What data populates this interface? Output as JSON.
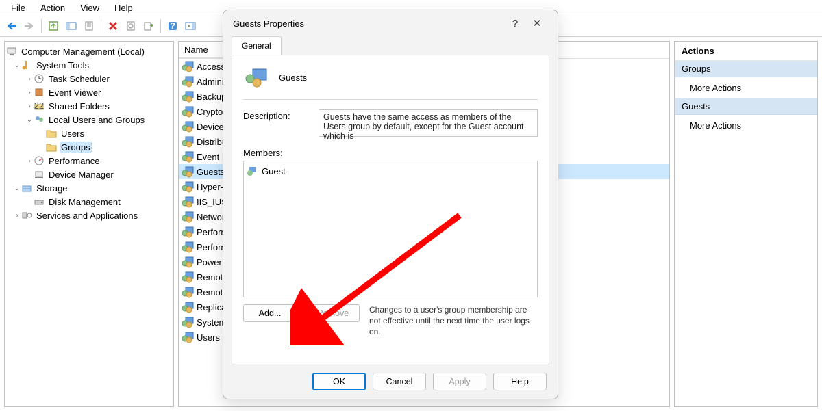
{
  "menu": {
    "file": "File",
    "action": "Action",
    "view": "View",
    "help": "Help"
  },
  "tree": {
    "root": "Computer Management (Local)",
    "system_tools": "System Tools",
    "task_scheduler": "Task Scheduler",
    "event_viewer": "Event Viewer",
    "shared_folders": "Shared Folders",
    "local_users": "Local Users and Groups",
    "users": "Users",
    "groups": "Groups",
    "performance": "Performance",
    "device_manager": "Device Manager",
    "storage": "Storage",
    "disk_management": "Disk Management",
    "services_apps": "Services and Applications"
  },
  "list": {
    "header": "Name",
    "items": [
      "Access",
      "Admini",
      "Backup",
      "Crypto",
      "Device",
      "Distribu",
      "Event L",
      "Guests",
      "Hyper-",
      "IIS_IUSI",
      "Networ",
      "Perforn",
      "Perforn",
      "Power U",
      "Remote",
      "Remote",
      "Replica",
      "System",
      "Users"
    ],
    "selected_index": 7
  },
  "actions": {
    "title": "Actions",
    "section1": "Groups",
    "item1": "More Actions",
    "section2": "Guests",
    "item2": "More Actions"
  },
  "dialog": {
    "title": "Guests Properties",
    "tab_general": "General",
    "group_name": "Guests",
    "desc_label": "Description:",
    "desc_text": "Guests have the same access as members of the Users group by default, except for the Guest account which is",
    "members_label": "Members:",
    "members": [
      "Guest"
    ],
    "add": "Add...",
    "remove": "Remove",
    "note": "Changes to a user's group membership are not effective until the next time the user logs on.",
    "ok": "OK",
    "cancel": "Cancel",
    "apply": "Apply",
    "help": "Help"
  }
}
